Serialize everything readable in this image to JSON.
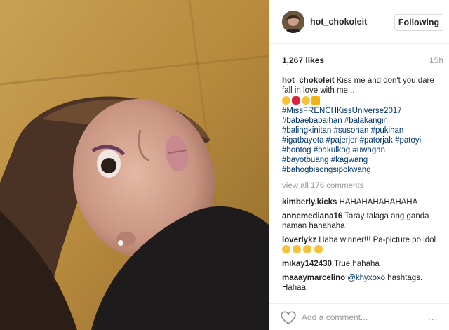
{
  "post": {
    "username": "hot_chokoleit",
    "follow_label": "Following",
    "likes": "1,267 likes",
    "time": "15h"
  },
  "caption": {
    "username": "hot_chokoleit",
    "text": "Kiss me and don't you dare fall in love with me...",
    "emojis": [
      "face-throwing-kiss-emoji",
      "kiss-mark-emoji",
      "grinning-face-emoji",
      "crown-emoji"
    ],
    "hashtags": [
      "#MissFRENCHKissUniverse2017",
      "#babaebabaihan #balakangin",
      "#balingkinitan #susohan #pukihan",
      "#igatbayota #pajerjer #patorjak #patoyi",
      "#bontog #pakulkog #uwagan",
      "#bayotbuang #kagwang",
      "#bahogbisongsipokwang"
    ]
  },
  "view_all": "view all 176 comments",
  "comments": [
    {
      "user": "kimberly.kicks",
      "text": "HAHAHAHAHAHAHA"
    },
    {
      "user": "annemediana16",
      "text": "Taray talaga ang ganda naman hahahaha"
    },
    {
      "user": "loverlykz",
      "text": "Haha winner!!! Pa-picture po idol",
      "emojis": 4
    },
    {
      "user": "mikay142430",
      "text": "True hahaha"
    },
    {
      "user": "maaaymarcelino",
      "mention": "@khyxoxo",
      "text": " hashtags. Hahaa!"
    }
  ],
  "add_comment": {
    "placeholder": "Add a comment...",
    "more": "..."
  },
  "colors": {
    "link": "#003569",
    "muted": "#999999",
    "text": "#262626"
  }
}
